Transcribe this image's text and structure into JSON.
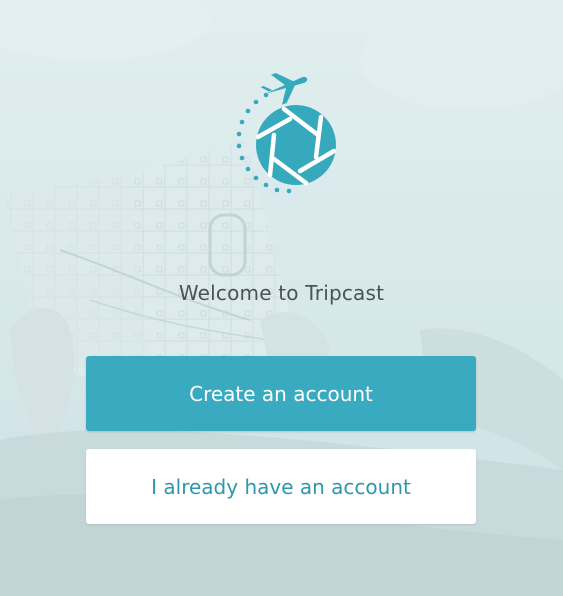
{
  "app": {
    "welcome_text": "Welcome to Tripcast",
    "logo_icon": "tripcast-logo-icon"
  },
  "actions": {
    "create_account_label": "Create an account",
    "existing_account_label": "I already have an account"
  },
  "colors": {
    "accent": "#39aabf",
    "secondary_text": "#2f97ad",
    "welcome_text": "#4a5358",
    "background_tint": "#cfe0e3"
  }
}
